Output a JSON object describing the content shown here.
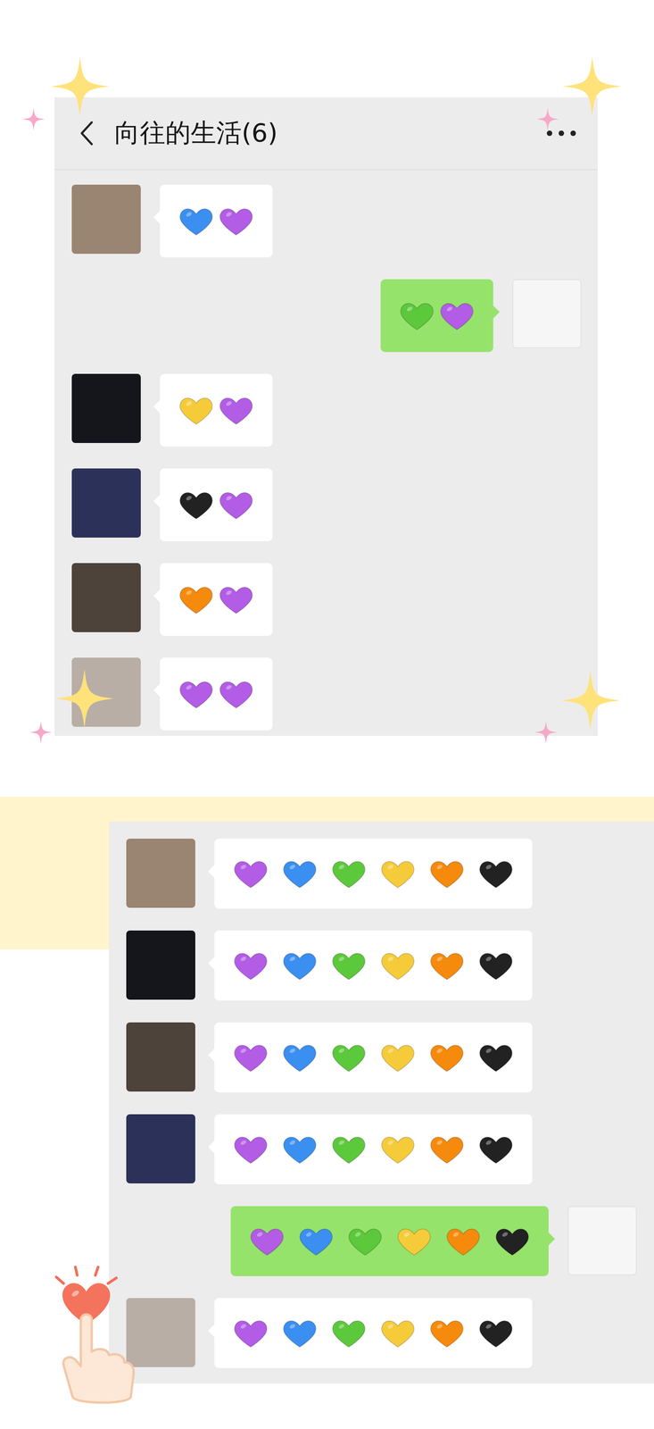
{
  "top_chat": {
    "header": {
      "title": "向往的生活(6)"
    },
    "messages": [
      {
        "mine": false,
        "avatar_color": "#9a8472",
        "hearts": [
          {
            "color": "#3b8ff0"
          },
          {
            "color": "#b35ce6"
          }
        ]
      },
      {
        "mine": true,
        "avatar_color": "#f6f6f6",
        "hearts": [
          {
            "color": "#5cc83c"
          },
          {
            "color": "#b35ce6"
          }
        ]
      },
      {
        "mine": false,
        "avatar_color": "#15151c",
        "hearts": [
          {
            "color": "#f6cb3a"
          },
          {
            "color": "#b35ce6"
          }
        ]
      },
      {
        "mine": false,
        "avatar_color": "#2b3158",
        "hearts": [
          {
            "color": "#222222"
          },
          {
            "color": "#b35ce6"
          }
        ]
      },
      {
        "mine": false,
        "avatar_color": "#4d433b",
        "hearts": [
          {
            "color": "#f68a0c"
          },
          {
            "color": "#b35ce6"
          }
        ]
      },
      {
        "mine": false,
        "avatar_color": "#b8aea6",
        "hearts": [
          {
            "color": "#b35ce6"
          },
          {
            "color": "#b35ce6"
          }
        ]
      }
    ]
  },
  "bottom_chat": {
    "messages": [
      {
        "mine": false,
        "avatar_color": "#9a8472",
        "hearts": [
          {
            "color": "#b35ce6"
          },
          {
            "color": "#3b8ff0"
          },
          {
            "color": "#5cc83c"
          },
          {
            "color": "#f6cb3a"
          },
          {
            "color": "#f68a0c"
          },
          {
            "color": "#222222"
          }
        ]
      },
      {
        "mine": false,
        "avatar_color": "#15151c",
        "hearts": [
          {
            "color": "#b35ce6"
          },
          {
            "color": "#3b8ff0"
          },
          {
            "color": "#5cc83c"
          },
          {
            "color": "#f6cb3a"
          },
          {
            "color": "#f68a0c"
          },
          {
            "color": "#222222"
          }
        ]
      },
      {
        "mine": false,
        "avatar_color": "#4d433b",
        "hearts": [
          {
            "color": "#b35ce6"
          },
          {
            "color": "#3b8ff0"
          },
          {
            "color": "#5cc83c"
          },
          {
            "color": "#f6cb3a"
          },
          {
            "color": "#f68a0c"
          },
          {
            "color": "#222222"
          }
        ]
      },
      {
        "mine": false,
        "avatar_color": "#2b3158",
        "hearts": [
          {
            "color": "#b35ce6"
          },
          {
            "color": "#3b8ff0"
          },
          {
            "color": "#5cc83c"
          },
          {
            "color": "#f6cb3a"
          },
          {
            "color": "#f68a0c"
          },
          {
            "color": "#222222"
          }
        ]
      },
      {
        "mine": true,
        "avatar_color": "#f6f6f6",
        "hearts": [
          {
            "color": "#b35ce6"
          },
          {
            "color": "#3b8ff0"
          },
          {
            "color": "#5cc83c"
          },
          {
            "color": "#f6cb3a"
          },
          {
            "color": "#f68a0c"
          },
          {
            "color": "#222222"
          }
        ]
      },
      {
        "mine": false,
        "avatar_color": "#b8aea6",
        "hearts": [
          {
            "color": "#b35ce6"
          },
          {
            "color": "#3b8ff0"
          },
          {
            "color": "#5cc83c"
          },
          {
            "color": "#f6cb3a"
          },
          {
            "color": "#f68a0c"
          },
          {
            "color": "#222222"
          }
        ]
      }
    ]
  }
}
